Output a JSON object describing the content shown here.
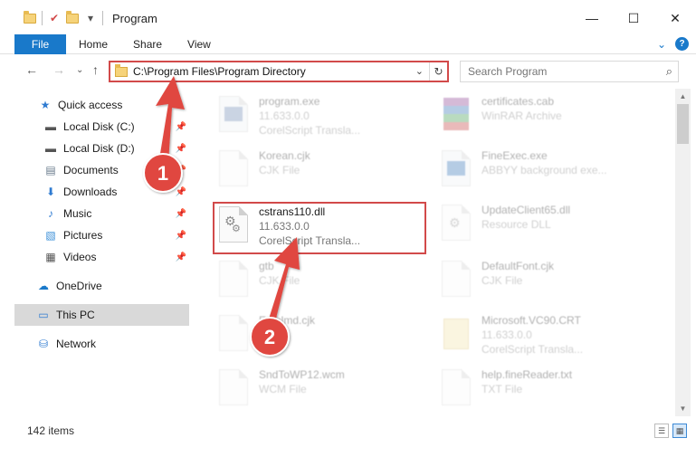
{
  "window": {
    "title": "Program",
    "minimize": "—",
    "maximize": "☐",
    "close": "✕"
  },
  "ribbon": {
    "file": "File",
    "tabs": [
      "Home",
      "Share",
      "View"
    ],
    "expand": "⌄",
    "help": "?"
  },
  "address": {
    "path": "C:\\Program Files\\Program Directory",
    "search_placeholder": "Search Program"
  },
  "nav": {
    "items": [
      {
        "label": "Quick access",
        "icon": "star-icon",
        "glyph": "★",
        "color": "#2f7bd1",
        "pinned": false
      },
      {
        "label": "Local Disk (C:)",
        "icon": "drive-icon",
        "glyph": "▬",
        "color": "#555555",
        "pinned": true
      },
      {
        "label": "Local Disk (D:)",
        "icon": "drive-icon",
        "glyph": "▬",
        "color": "#555555",
        "pinned": true
      },
      {
        "label": "Documents",
        "icon": "documents-icon",
        "glyph": "▤",
        "color": "#6a7b8c",
        "pinned": true
      },
      {
        "label": "Downloads",
        "icon": "download-icon",
        "glyph": "⬇",
        "color": "#2f7bd1",
        "pinned": true
      },
      {
        "label": "Music",
        "icon": "music-icon",
        "glyph": "♪",
        "color": "#2f7bd1",
        "pinned": true
      },
      {
        "label": "Pictures",
        "icon": "pictures-icon",
        "glyph": "▧",
        "color": "#3a8fd8",
        "pinned": true
      },
      {
        "label": "Videos",
        "icon": "videos-icon",
        "glyph": "▦",
        "color": "#555555",
        "pinned": true
      },
      {
        "label": "OneDrive",
        "icon": "cloud-icon",
        "glyph": "☁",
        "color": "#1979ca",
        "pinned": false
      },
      {
        "label": "This PC",
        "icon": "monitor-icon",
        "glyph": "▭",
        "color": "#2f7bd1",
        "pinned": false
      },
      {
        "label": "Network",
        "icon": "network-icon",
        "glyph": "⛁",
        "color": "#2f7bd1",
        "pinned": false
      }
    ]
  },
  "files": [
    {
      "name": "program.exe",
      "meta1": "11.633.0.0",
      "meta2": "CorelScript Transla...",
      "faded": true
    },
    {
      "name": "certificates.cab",
      "meta1": "WinRAR Archive",
      "meta2": "",
      "faded": true
    },
    {
      "name": "Korean.cjk",
      "meta1": "CJK File",
      "meta2": "",
      "faded": true
    },
    {
      "name": "FineExec.exe",
      "meta1": "ABBYY background exe...",
      "meta2": "",
      "faded": true
    },
    {
      "name": "cstrans110.dll",
      "meta1": "11.633.0.0",
      "meta2": "CorelScript Transla...",
      "faded": false
    },
    {
      "name": "UpdateClient65.dll",
      "meta1": "Resource DLL",
      "meta2": "",
      "faded": true
    },
    {
      "name": "gtb",
      "meta1": "CJK File",
      "meta2": "",
      "faded": true
    },
    {
      "name": "DefaultFont.cjk",
      "meta1": "CJK File",
      "meta2": "",
      "faded": true
    },
    {
      "name": "Emblmd.cjk",
      "meta1": "",
      "meta2": "",
      "faded": true
    },
    {
      "name": "Microsoft.VC90.CRT",
      "meta1": "11.633.0.0",
      "meta2": "CorelScript Transla...",
      "faded": true
    },
    {
      "name": "SndToWP12.wcm",
      "meta1": "WCM File",
      "meta2": "",
      "faded": true
    },
    {
      "name": "help.fineReader.txt",
      "meta1": "TXT File",
      "meta2": "",
      "faded": true
    }
  ],
  "status": {
    "count": "142 items"
  },
  "callouts": {
    "one": "1",
    "two": "2",
    "color": "#e0463f"
  }
}
